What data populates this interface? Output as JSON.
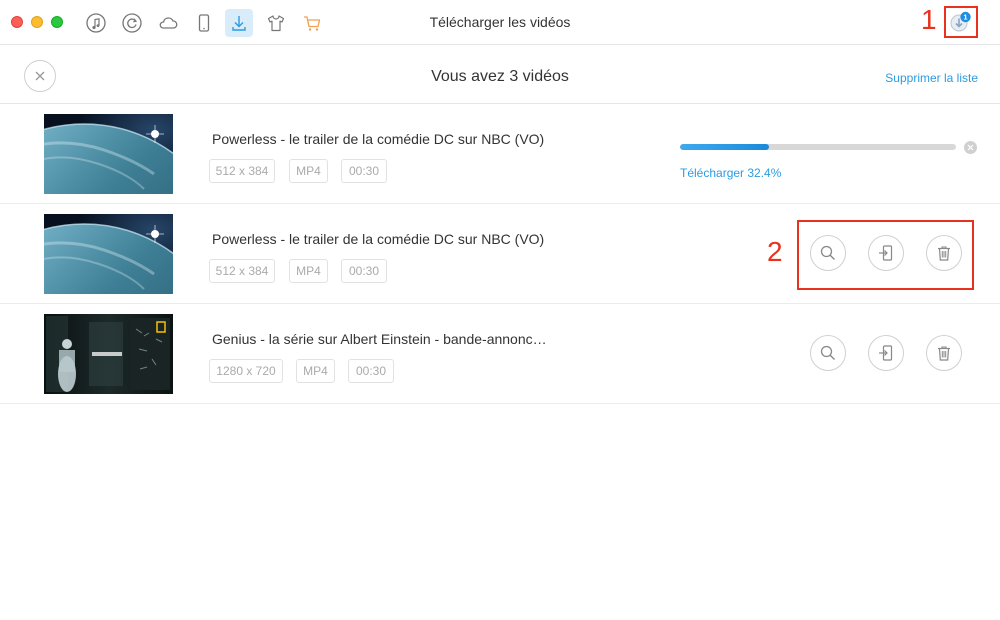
{
  "window": {
    "title": "Télécharger les vidéos"
  },
  "toolbar": {
    "icons": [
      "music-note-icon",
      "restore-icon",
      "cloud-icon",
      "phone-icon",
      "download-icon",
      "tshirt-icon",
      "cart-icon"
    ],
    "active": "download-icon",
    "badge_count": "1"
  },
  "header": {
    "title": "Vous avez 3 vidéos",
    "clear_label": "Supprimer la liste"
  },
  "videos": [
    {
      "title": "Powerless - le trailer de la comédie DC sur NBC (VO)",
      "resolution": "512 x 384",
      "format": "MP4",
      "duration": "00:30",
      "status": "downloading",
      "progress": 0.324,
      "progress_text": "Télécharger 32.4%"
    },
    {
      "title": "Powerless - le trailer de la comédie DC sur NBC (VO)",
      "resolution": "512 x 384",
      "format": "MP4",
      "duration": "00:30",
      "status": "done"
    },
    {
      "title": "Genius - la série sur Albert Einstein - bande-annonc…",
      "resolution": "1280 x 720",
      "format": "MP4",
      "duration": "00:30",
      "status": "done"
    }
  ],
  "annotations": {
    "one": "1",
    "two": "2"
  },
  "colors": {
    "accent": "#2d9be0",
    "annotation": "#e8321e",
    "cart": "#f0a050"
  }
}
